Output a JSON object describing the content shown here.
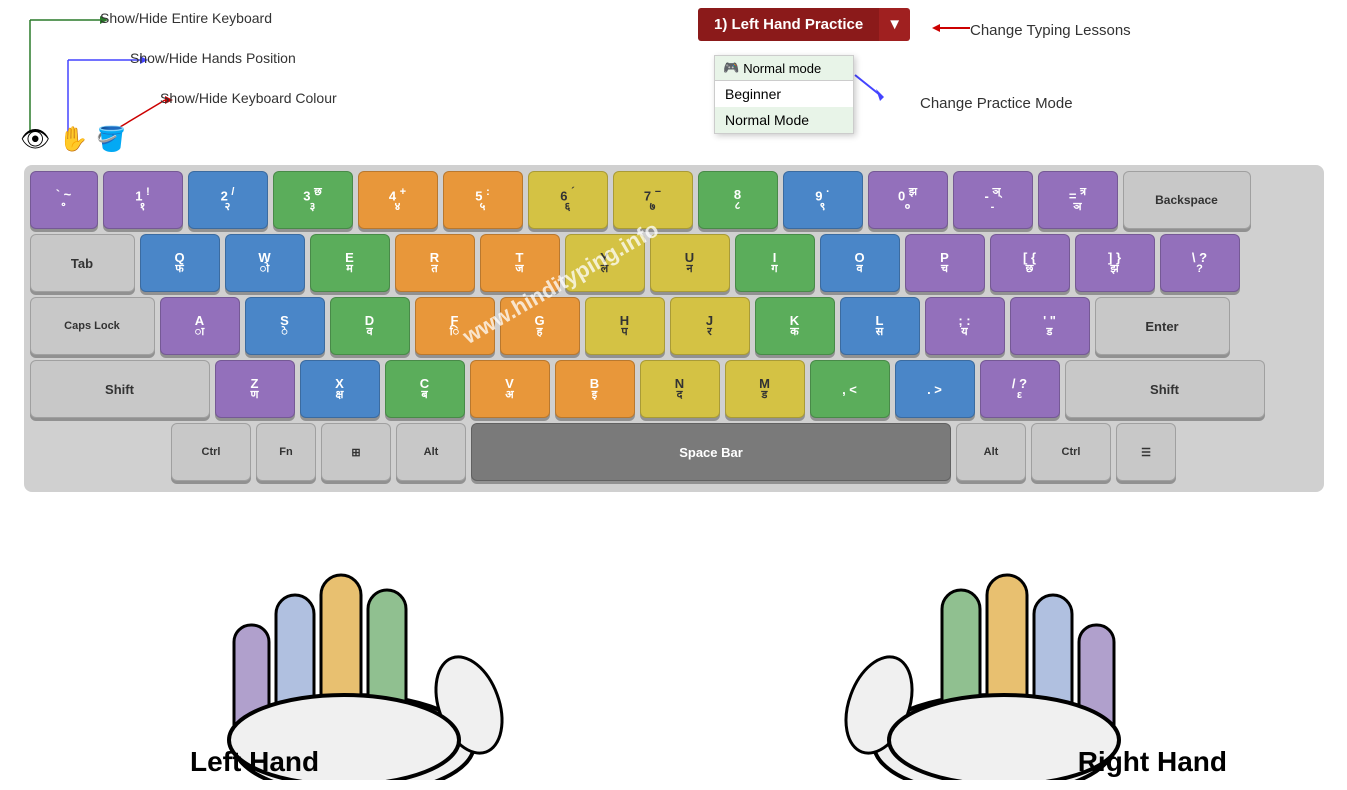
{
  "header": {
    "lesson_label": "1) Left Hand Practice",
    "dropdown_arrow": "▼",
    "change_lessons_label": "Change Typing Lessons",
    "change_mode_label": "Change Practice Mode",
    "show_hide_keyboard": "Show/Hide Entire Keyboard",
    "show_hide_hands": "Show/Hide Hands Position",
    "show_hide_colour": "Show/Hide Keyboard Colour"
  },
  "mode_dropdown": {
    "header": "Normal mode",
    "options": [
      "Beginner",
      "Normal Mode"
    ]
  },
  "icons": {
    "eye": "👁",
    "hand": "✋",
    "paint": "🪣"
  },
  "keyboard": {
    "rows": [
      {
        "keys": [
          {
            "label": "` ~",
            "hindi": "॰ ~",
            "color": "purple"
          },
          {
            "label": "1 !",
            "hindi": "१ !",
            "color": "purple"
          },
          {
            "label": "2 @",
            "hindi": "२ /",
            "color": "blue"
          },
          {
            "label": "3 #",
            "hindi": "३ छ",
            "color": "green"
          },
          {
            "label": "4 $",
            "hindi": "४ +",
            "color": "orange"
          },
          {
            "label": "5 %",
            "hindi": "५ :",
            "color": "orange"
          },
          {
            "label": "6 ^",
            "hindi": "६ ´",
            "color": "yellow"
          },
          {
            "label": "7 &",
            "hindi": "७ −",
            "color": "yellow"
          },
          {
            "label": "8 *",
            "hindi": "८",
            "color": "green"
          },
          {
            "label": "9 (",
            "hindi": "९ ·",
            "color": "blue"
          },
          {
            "label": "0 )",
            "hindi": "० झ",
            "color": "purple"
          },
          {
            "label": "- _",
            "hindi": "- ञ्",
            "color": "purple"
          },
          {
            "label": "= +",
            "hindi": "ञ त्र",
            "color": "purple"
          },
          {
            "label": "Backspace",
            "hindi": "",
            "color": "light-gray",
            "wide": true
          }
        ]
      },
      {
        "keys": [
          {
            "label": "Tab",
            "hindi": "",
            "color": "light-gray",
            "wide": true
          },
          {
            "label": "Q",
            "hindi": "फ",
            "color": "blue"
          },
          {
            "label": "W",
            "hindi": "ो",
            "color": "blue"
          },
          {
            "label": "E",
            "hindi": "म",
            "color": "green"
          },
          {
            "label": "R",
            "hindi": "त",
            "color": "orange"
          },
          {
            "label": "T",
            "hindi": "ज",
            "color": "orange"
          },
          {
            "label": "Y",
            "hindi": "ल",
            "color": "yellow"
          },
          {
            "label": "U",
            "hindi": "न",
            "color": "yellow"
          },
          {
            "label": "I",
            "hindi": "ग",
            "color": "green"
          },
          {
            "label": "O",
            "hindi": "व",
            "color": "blue"
          },
          {
            "label": "P",
            "hindi": "च",
            "color": "purple"
          },
          {
            "label": "[ {",
            "hindi": "छ",
            "color": "purple"
          },
          {
            "label": "] }",
            "hindi": "झ",
            "color": "purple"
          },
          {
            "label": "\\ |",
            "hindi": "?",
            "color": "purple"
          }
        ]
      },
      {
        "keys": [
          {
            "label": "Caps Lock",
            "hindi": "",
            "color": "light-gray",
            "wide": true
          },
          {
            "label": "A",
            "hindi": "ा",
            "color": "purple"
          },
          {
            "label": "S",
            "hindi": "े",
            "color": "blue"
          },
          {
            "label": "D",
            "hindi": "व",
            "color": "green"
          },
          {
            "label": "F",
            "hindi": "ि",
            "color": "orange"
          },
          {
            "label": "G",
            "hindi": "ह",
            "color": "orange"
          },
          {
            "label": "H",
            "hindi": "प",
            "color": "yellow"
          },
          {
            "label": "J",
            "hindi": "र",
            "color": "yellow"
          },
          {
            "label": "K",
            "hindi": "क",
            "color": "green"
          },
          {
            "label": "L",
            "hindi": "स",
            "color": "blue"
          },
          {
            "label": "; :",
            "hindi": "य",
            "color": "purple"
          },
          {
            "label": "' \"",
            "hindi": "ड",
            "color": "purple"
          },
          {
            "label": "Enter",
            "hindi": "",
            "color": "light-gray",
            "wide": true
          }
        ]
      },
      {
        "keys": [
          {
            "label": "Shift",
            "hindi": "",
            "color": "light-gray",
            "wide": true
          },
          {
            "label": "Z",
            "hindi": "ण",
            "color": "purple"
          },
          {
            "label": "X",
            "hindi": "क्ष",
            "color": "blue"
          },
          {
            "label": "C",
            "hindi": "ब",
            "color": "green"
          },
          {
            "label": "V",
            "hindi": "अ",
            "color": "orange"
          },
          {
            "label": "B",
            "hindi": "इ",
            "color": "orange"
          },
          {
            "label": "N",
            "hindi": "द",
            "color": "yellow"
          },
          {
            "label": "M",
            "hindi": "ड",
            "color": "yellow"
          },
          {
            "label": ", <",
            "hindi": "",
            "color": "green"
          },
          {
            "label": ". >",
            "hindi": "",
            "color": "blue"
          },
          {
            "label": "/ ?",
            "hindi": "ε",
            "color": "purple"
          },
          {
            "label": "Shift",
            "hindi": "",
            "color": "light-gray",
            "wide": true
          }
        ]
      }
    ],
    "spacebar": "Space Bar",
    "left_hand_label": "Left Hand",
    "right_hand_label": "Right Hand"
  },
  "watermark": "www.hindityping.info"
}
